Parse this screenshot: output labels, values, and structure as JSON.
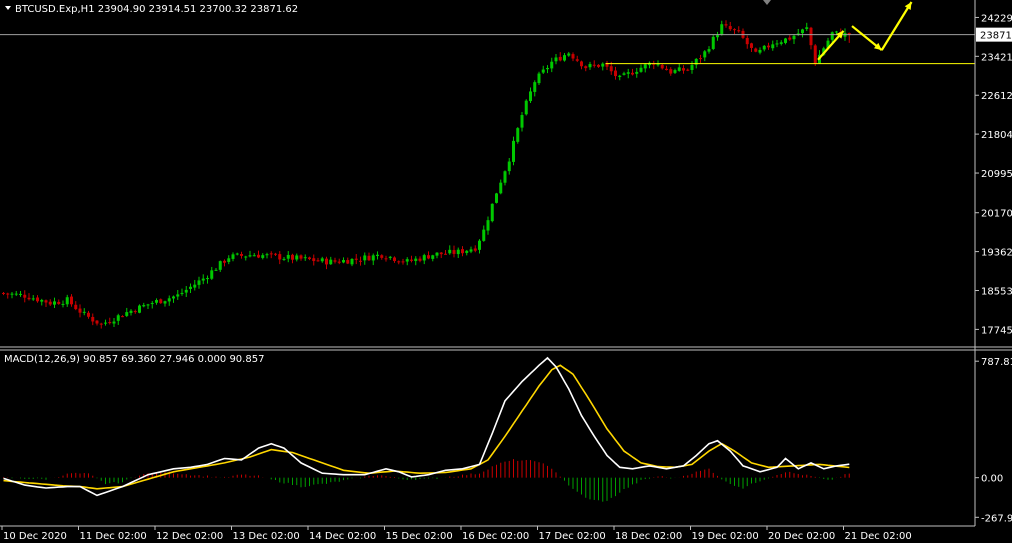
{
  "header": {
    "main": "BTCUSD.Exp,H1  23904.90 23914.51 23700.32 23871.62",
    "macd": "MACD(12,26,9) 90.857 69.360 27.946 0.000 90.857"
  },
  "colors": {
    "background": "#000000",
    "bull": "#00c800",
    "bear": "#c80000",
    "macd_line": "#ffffff",
    "signal_line": "#ffd700",
    "hist_pos": "#c80000",
    "hist_neg": "#00a000",
    "arrows": "#ffff00",
    "price_line": "#a0a0a0"
  },
  "chart_data": [
    {
      "type": "candlestick",
      "symbol": "BTCUSD.Exp",
      "timeframe": "H1",
      "ohlc_last": {
        "open": 23904.9,
        "high": 23914.51,
        "low": 23700.32,
        "close": 23871.62
      },
      "current_price_label": "23871.",
      "current_price": 23871.62,
      "ylim": [
        17400,
        24550
      ],
      "yticks": [
        "24229.",
        "23421.",
        "22612.",
        "21804.",
        "20995.",
        "20170.",
        "19362.",
        "18553.",
        "17745."
      ],
      "ytick_values": [
        24229,
        23421,
        22612,
        21804,
        20995,
        20170,
        19362,
        18553,
        17745
      ],
      "xticks": [
        "10 Dec 2020",
        "11 Dec 02:00",
        "12 Dec 02:00",
        "13 Dec 02:00",
        "14 Dec 02:00",
        "15 Dec 02:00",
        "16 Dec 02:00",
        "17 Dec 02:00",
        "18 Dec 02:00",
        "19 Dec 02:00",
        "20 Dec 02:00",
        "21 Dec 02:00"
      ],
      "close_path": [
        [
          0,
          18500
        ],
        [
          6,
          18450
        ],
        [
          12,
          18300
        ],
        [
          16,
          18350
        ],
        [
          20,
          18050
        ],
        [
          24,
          17850
        ],
        [
          30,
          18100
        ],
        [
          36,
          18300
        ],
        [
          42,
          18450
        ],
        [
          48,
          18800
        ],
        [
          54,
          19250
        ],
        [
          60,
          19300
        ],
        [
          66,
          19250
        ],
        [
          72,
          19200
        ],
        [
          78,
          19150
        ],
        [
          84,
          19200
        ],
        [
          90,
          19300
        ],
        [
          96,
          19150
        ],
        [
          102,
          19300
        ],
        [
          108,
          19350
        ],
        [
          112,
          19450
        ],
        [
          114,
          19800
        ],
        [
          117,
          20600
        ],
        [
          120,
          21300
        ],
        [
          123,
          22200
        ],
        [
          126,
          22900
        ],
        [
          130,
          23300
        ],
        [
          134,
          23500
        ],
        [
          138,
          23200
        ],
        [
          142,
          23250
        ],
        [
          146,
          22950
        ],
        [
          150,
          23150
        ],
        [
          154,
          23300
        ],
        [
          158,
          23100
        ],
        [
          162,
          23150
        ],
        [
          166,
          23500
        ],
        [
          170,
          24050
        ],
        [
          174,
          23900
        ],
        [
          178,
          23450
        ],
        [
          182,
          23700
        ],
        [
          186,
          23800
        ],
        [
          190,
          24000
        ],
        [
          192,
          23300
        ],
        [
          196,
          23900
        ],
        [
          199,
          23871.62
        ]
      ],
      "annotations": {
        "resistance_level": 23270,
        "resistance_start_hour": 142,
        "upper_line": 23871.62,
        "arrow_path": [
          [
            192,
            23350
          ],
          [
            198,
            23950
          ],
          [
            200,
            24050
          ],
          [
            207,
            23550
          ],
          [
            214,
            24550
          ]
        ]
      }
    },
    {
      "type": "macd",
      "params": "12,26,9",
      "macd_value": 90.857,
      "signal_value": 69.36,
      "ylim": [
        -320,
        850
      ],
      "yticks": [
        "787.817",
        "0.00",
        "-267.927"
      ],
      "ytick_values": [
        787.817,
        0,
        -267.927
      ],
      "macd_keys": [
        [
          0,
          -5
        ],
        [
          5,
          -50
        ],
        [
          10,
          -70
        ],
        [
          15,
          -60
        ],
        [
          18,
          -60
        ],
        [
          22,
          -120
        ],
        [
          28,
          -60
        ],
        [
          34,
          20
        ],
        [
          40,
          60
        ],
        [
          44,
          70
        ],
        [
          48,
          90
        ],
        [
          52,
          130
        ],
        [
          56,
          120
        ],
        [
          60,
          200
        ],
        [
          63,
          230
        ],
        [
          66,
          200
        ],
        [
          70,
          100
        ],
        [
          75,
          30
        ],
        [
          80,
          20
        ],
        [
          85,
          20
        ],
        [
          90,
          60
        ],
        [
          93,
          40
        ],
        [
          96,
          5
        ],
        [
          100,
          20
        ],
        [
          104,
          50
        ],
        [
          108,
          60
        ],
        [
          112,
          90
        ],
        [
          115,
          300
        ],
        [
          118,
          520
        ],
        [
          122,
          650
        ],
        [
          126,
          760
        ],
        [
          128,
          810
        ],
        [
          130,
          750
        ],
        [
          133,
          600
        ],
        [
          136,
          420
        ],
        [
          139,
          280
        ],
        [
          142,
          150
        ],
        [
          145,
          70
        ],
        [
          148,
          60
        ],
        [
          152,
          80
        ],
        [
          156,
          60
        ],
        [
          160,
          80
        ],
        [
          163,
          150
        ],
        [
          166,
          230
        ],
        [
          168,
          250
        ],
        [
          171,
          180
        ],
        [
          174,
          80
        ],
        [
          178,
          40
        ],
        [
          182,
          70
        ],
        [
          184,
          130
        ],
        [
          187,
          60
        ],
        [
          190,
          100
        ],
        [
          193,
          60
        ],
        [
          196,
          80
        ],
        [
          199,
          91
        ]
      ],
      "signal_keys": [
        [
          0,
          -20
        ],
        [
          8,
          -40
        ],
        [
          14,
          -55
        ],
        [
          18,
          -60
        ],
        [
          22,
          -75
        ],
        [
          28,
          -60
        ],
        [
          34,
          -10
        ],
        [
          40,
          40
        ],
        [
          46,
          70
        ],
        [
          52,
          100
        ],
        [
          58,
          140
        ],
        [
          63,
          190
        ],
        [
          68,
          170
        ],
        [
          74,
          110
        ],
        [
          80,
          50
        ],
        [
          86,
          30
        ],
        [
          92,
          45
        ],
        [
          98,
          30
        ],
        [
          104,
          35
        ],
        [
          110,
          60
        ],
        [
          114,
          120
        ],
        [
          118,
          280
        ],
        [
          122,
          450
        ],
        [
          126,
          620
        ],
        [
          129,
          730
        ],
        [
          131,
          760
        ],
        [
          134,
          700
        ],
        [
          138,
          520
        ],
        [
          142,
          330
        ],
        [
          146,
          180
        ],
        [
          150,
          100
        ],
        [
          154,
          75
        ],
        [
          158,
          70
        ],
        [
          162,
          90
        ],
        [
          166,
          180
        ],
        [
          169,
          230
        ],
        [
          172,
          180
        ],
        [
          176,
          100
        ],
        [
          180,
          70
        ],
        [
          186,
          80
        ],
        [
          192,
          90
        ],
        [
          199,
          69
        ]
      ],
      "hist_keys": [
        [
          0,
          0
        ],
        [
          10,
          -10
        ],
        [
          16,
          30
        ],
        [
          20,
          25
        ],
        [
          24,
          -40
        ],
        [
          28,
          -30
        ],
        [
          32,
          20
        ],
        [
          38,
          40
        ],
        [
          44,
          20
        ],
        [
          52,
          0
        ],
        [
          56,
          20
        ],
        [
          60,
          10
        ],
        [
          64,
          -20
        ],
        [
          70,
          -60
        ],
        [
          76,
          -40
        ],
        [
          82,
          -10
        ],
        [
          88,
          20
        ],
        [
          94,
          -10
        ],
        [
          100,
          -10
        ],
        [
          106,
          10
        ],
        [
          112,
          30
        ],
        [
          116,
          90
        ],
        [
          120,
          120
        ],
        [
          126,
          110
        ],
        [
          130,
          40
        ],
        [
          134,
          -80
        ],
        [
          138,
          -150
        ],
        [
          142,
          -160
        ],
        [
          146,
          -80
        ],
        [
          150,
          -20
        ],
        [
          154,
          10
        ],
        [
          158,
          -5
        ],
        [
          162,
          30
        ],
        [
          166,
          60
        ],
        [
          170,
          -30
        ],
        [
          174,
          -70
        ],
        [
          178,
          -20
        ],
        [
          184,
          40
        ],
        [
          190,
          10
        ],
        [
          194,
          -20
        ],
        [
          199,
          28
        ]
      ]
    }
  ]
}
